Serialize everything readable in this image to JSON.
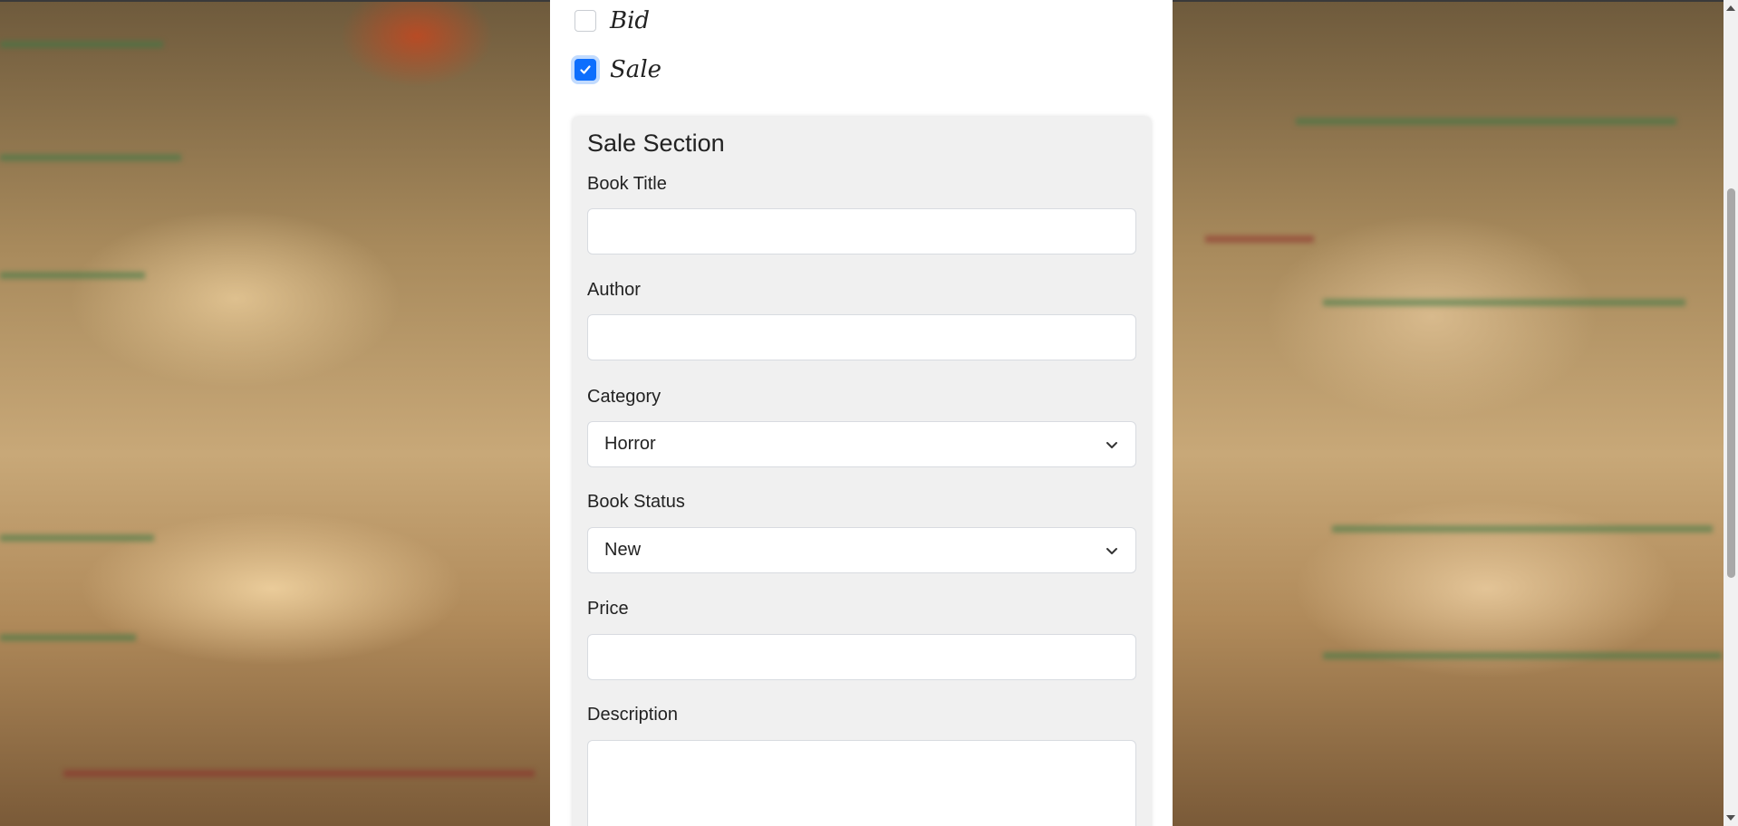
{
  "options": {
    "bid_label": "Bid",
    "bid_checked": false,
    "sale_label": "Sale",
    "sale_checked": true
  },
  "sale_section": {
    "title": "Sale Section",
    "fields": {
      "book_title_label": "Book Title",
      "book_title_value": "",
      "author_label": "Author",
      "author_value": "",
      "category_label": "Category",
      "category_selected": "Horror",
      "book_status_label": "Book Status",
      "book_status_selected": "New",
      "price_label": "Price",
      "price_value": "",
      "description_label": "Description",
      "description_value": ""
    }
  },
  "colors": {
    "accent": "#0d6efd",
    "section_bg": "#f0f0f0",
    "panel_bg": "#ffffff"
  },
  "icons": {
    "checkmark": "check-icon",
    "select_arrow": "chevron-down-icon",
    "scroll_up": "scroll-up-arrow-icon",
    "scroll_down": "scroll-down-arrow-icon"
  }
}
